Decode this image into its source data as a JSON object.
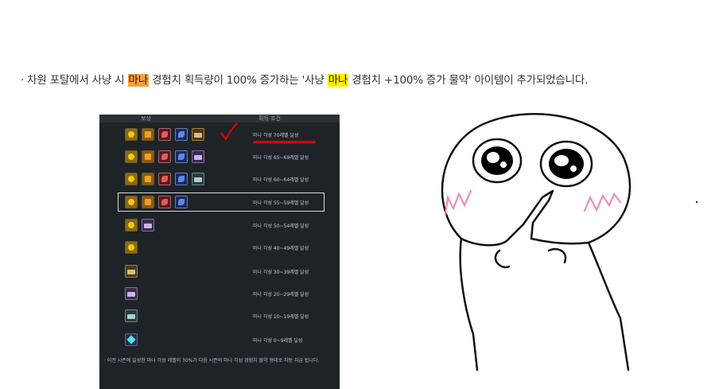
{
  "notice": {
    "bullet": "·",
    "part1": " 차원 포탈에서 사냥 시 ",
    "mana1": "마나",
    "part2": " 경험치 획득량이 100% 증가하는 '사냥 ",
    "mana2": "마나",
    "part3": " 경험치 +100% 증가 물약' 아이템이 추가되었습니다."
  },
  "reward_table": {
    "header_reward": "보상",
    "header_condition": "획득 조건",
    "rows": [
      {
        "icons": [
          "gold-coin",
          "gold-book",
          "red-feather",
          "blue-feather",
          "chest"
        ],
        "condition": "마나 각성 70레벨 달성"
      },
      {
        "icons": [
          "gold-coin",
          "gold-book",
          "red-feather",
          "blue-feather",
          "purple-chest"
        ],
        "condition": "마나 각성 65~69레벨 달성"
      },
      {
        "icons": [
          "gold-coin",
          "gold-book",
          "red-feather",
          "blue-feather",
          "teal-chest"
        ],
        "condition": "마나 각성 60~64레벨 달성"
      },
      {
        "icons": [
          "gold-coin",
          "gold-book",
          "red-feather",
          "blue-feather"
        ],
        "condition": "마나 각성 55~59레벨 달성"
      },
      {
        "icons": [
          "gold-coin",
          "purple-chest"
        ],
        "condition": "마나 각성 50~54레벨 달성"
      },
      {
        "icons": [
          "gold-coin"
        ],
        "condition": "마나 각성 40~49레벨 달성"
      },
      {
        "icons": [
          "chest"
        ],
        "condition": "마나 각성 30~39레벨 달성"
      },
      {
        "icons": [
          "purple-chest"
        ],
        "condition": "마나 각성 20~29레벨 달성"
      },
      {
        "icons": [
          "teal-chest"
        ],
        "condition": "마나 각성 10~19레벨 달성"
      },
      {
        "icons": [
          "crystal-shard"
        ],
        "condition": "마나 각성 0~9레벨 달성"
      }
    ],
    "footnote": "· 이전 시즌에 달성한 마나 각성 레벨의 30%가 다음 시즌의 마나 각성 경험치 물약 형태로 자동 지급 됩니다."
  },
  "colors": {
    "highlight_orange": "#f6a13a",
    "highlight_yellow": "#ffee00",
    "panel_bg": "#1e2327",
    "mark_red": "#e00000",
    "blush_pink": "#f08fb0"
  }
}
